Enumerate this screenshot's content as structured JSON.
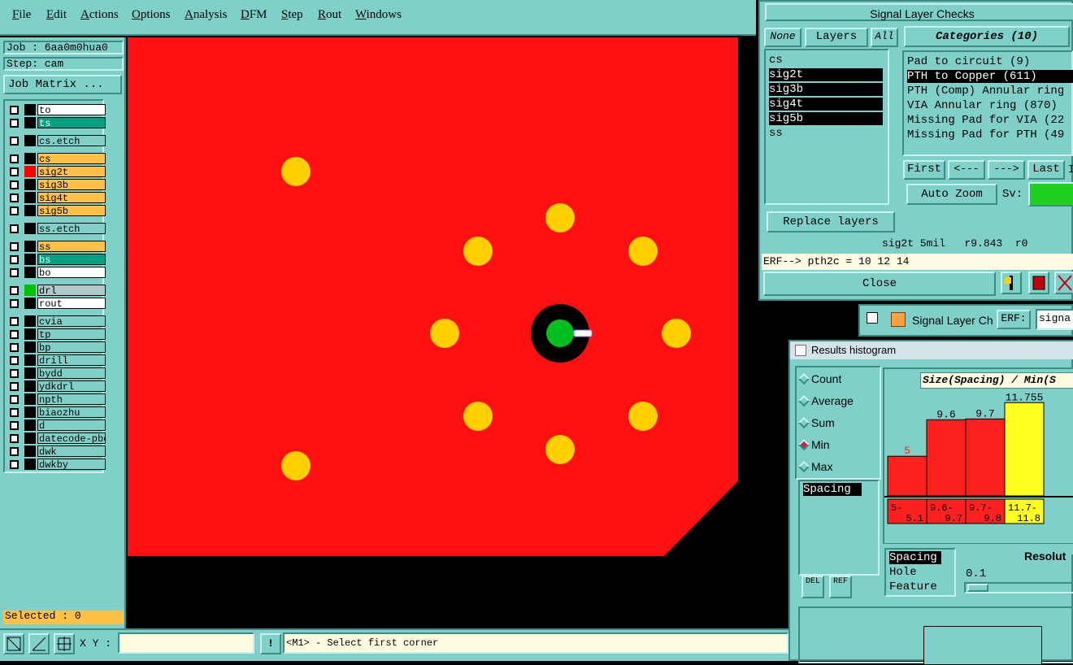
{
  "menu": [
    {
      "label": "File",
      "underline": "F",
      "rest": "ile"
    },
    {
      "label": "Edit",
      "underline": "E",
      "rest": "dit"
    },
    {
      "label": "Actions",
      "underline": "A",
      "rest": "ctions"
    },
    {
      "label": "Options",
      "underline": "O",
      "rest": "ptions"
    },
    {
      "label": "Analysis",
      "underline": "A",
      "rest": "nalysis"
    },
    {
      "label": "DFM",
      "underline": "D",
      "rest": "FM"
    },
    {
      "label": "Step",
      "underline": "S",
      "rest": "tep"
    },
    {
      "label": "Rout",
      "underline": "R",
      "rest": "out"
    },
    {
      "label": "Windows",
      "underline": "W",
      "rest": "indows"
    }
  ],
  "left": {
    "job": "Job : 6aa0m0hua0",
    "step": "Step: cam",
    "job_matrix": "Job Matrix ...",
    "selected": "Selected : 0",
    "layers": [
      {
        "name": "to",
        "style": "white",
        "color": "#000000"
      },
      {
        "name": "ts",
        "style": "teal2",
        "color": "#000000"
      },
      {
        "name": "cs.etch",
        "style": "blue",
        "color": "#000000"
      },
      {
        "name": "cs",
        "style": "orange",
        "color": "#000000"
      },
      {
        "name": "sig2t",
        "style": "orange",
        "color": "#ff0000"
      },
      {
        "name": "sig3b",
        "style": "orange",
        "color": "#000000"
      },
      {
        "name": "sig4t",
        "style": "orange",
        "color": "#000000"
      },
      {
        "name": "sig5b",
        "style": "orange",
        "color": "#000000"
      },
      {
        "name": "ss.etch",
        "style": "blue",
        "color": "#000000"
      },
      {
        "name": "ss",
        "style": "orange",
        "color": "#000000"
      },
      {
        "name": "bs",
        "style": "teal2",
        "color": "#000000"
      },
      {
        "name": "bo",
        "style": "white",
        "color": "#000000"
      },
      {
        "name": "drl",
        "style": "gray",
        "color": "#00c000"
      },
      {
        "name": "rout",
        "style": "white",
        "color": "#000000"
      },
      {
        "name": "cvia",
        "style": "blue",
        "color": "#000000"
      },
      {
        "name": "tp",
        "style": "blue",
        "color": "#000000"
      },
      {
        "name": "bp",
        "style": "blue",
        "color": "#000000"
      },
      {
        "name": "drill",
        "style": "blue",
        "color": "#000000"
      },
      {
        "name": "bydd",
        "style": "blue",
        "color": "#000000"
      },
      {
        "name": "ydkdrl",
        "style": "blue",
        "color": "#000000"
      },
      {
        "name": "npth",
        "style": "blue",
        "color": "#000000"
      },
      {
        "name": "biaozhu",
        "style": "blue",
        "color": "#000000"
      },
      {
        "name": "d",
        "style": "blue",
        "color": "#000000"
      },
      {
        "name": "datecode-pbo",
        "style": "blue",
        "color": "#000000"
      },
      {
        "name": "dwk",
        "style": "blue",
        "color": "#000000"
      },
      {
        "name": "dwkby",
        "style": "blue",
        "color": "#000000"
      }
    ]
  },
  "bottom": {
    "xy_label": "X Y :",
    "xy_value": "",
    "prompt": "<M1> - Select first corner"
  },
  "slc": {
    "title": "Signal Layer Checks",
    "btn_none": "None",
    "btn_layers": "Layers",
    "btn_all": "All",
    "layers": [
      "cs",
      "sig2t",
      "sig3b",
      "sig4t",
      "sig5b",
      "ss"
    ],
    "categories_label": "Categories (10)",
    "categories": [
      "Pad to circuit (9)",
      "PTH to Copper (611)",
      "PTH (Comp) Annular ring",
      "VIA Annular ring (870)",
      "Missing Pad for VIA (22",
      "Missing Pad for PTH (49"
    ],
    "nav_first": "First",
    "nav_prev": "<---",
    "nav_next": "--->",
    "nav_last": "Last",
    "nav_last2": "I",
    "auto_zoom": "Auto Zoom",
    "sv_label": "Sv:",
    "replace_layers": "Replace layers",
    "status": "sig2t 5mil   r9.843  r0",
    "erf": "ERF--> pth2c = 10 12 14",
    "close": "Close"
  },
  "slc2": {
    "title": "Signal Layer Ch",
    "erf_btn": "ERF:",
    "field": "signa"
  },
  "hist": {
    "title": "Results histogram",
    "radios": [
      {
        "label": "Count",
        "on": false
      },
      {
        "label": "Average",
        "on": false
      },
      {
        "label": "Sum",
        "on": false
      },
      {
        "label": "Min",
        "on": true
      },
      {
        "label": "Max",
        "on": false
      }
    ],
    "attr_list": [
      "Spacing"
    ],
    "del_label": "DEL",
    "ref_label": "REF",
    "chart_title": "Size(Spacing) / Min(S",
    "types": [
      "Spacing",
      "Hole",
      "Feature"
    ],
    "resolution_label": "Resolut",
    "resolution_value": "0.1"
  },
  "chart_data": {
    "type": "bar",
    "title": "Size(Spacing) / Min(S",
    "categories": [
      "5-\n5.1",
      "9.6-\n9.7",
      "9.7-\n9.8",
      "11.7-\n11.8"
    ],
    "category_labels": [
      [
        "5-",
        "5.1"
      ],
      [
        "9.6-",
        "9.7"
      ],
      [
        "9.7-",
        "9.8"
      ],
      [
        "11.7-",
        "11.8"
      ]
    ],
    "values": [
      5,
      9.6,
      9.7,
      11.755
    ],
    "value_labels": [
      "5",
      "9.6",
      "9.7",
      "11.755"
    ],
    "colors": [
      "#ff2020",
      "#ff2020",
      "#ff2020",
      "#ffff20"
    ],
    "value_label_colors": [
      "#ff2020",
      "#000000",
      "#000000",
      "#000000"
    ],
    "ylim": [
      0,
      12.5
    ]
  }
}
